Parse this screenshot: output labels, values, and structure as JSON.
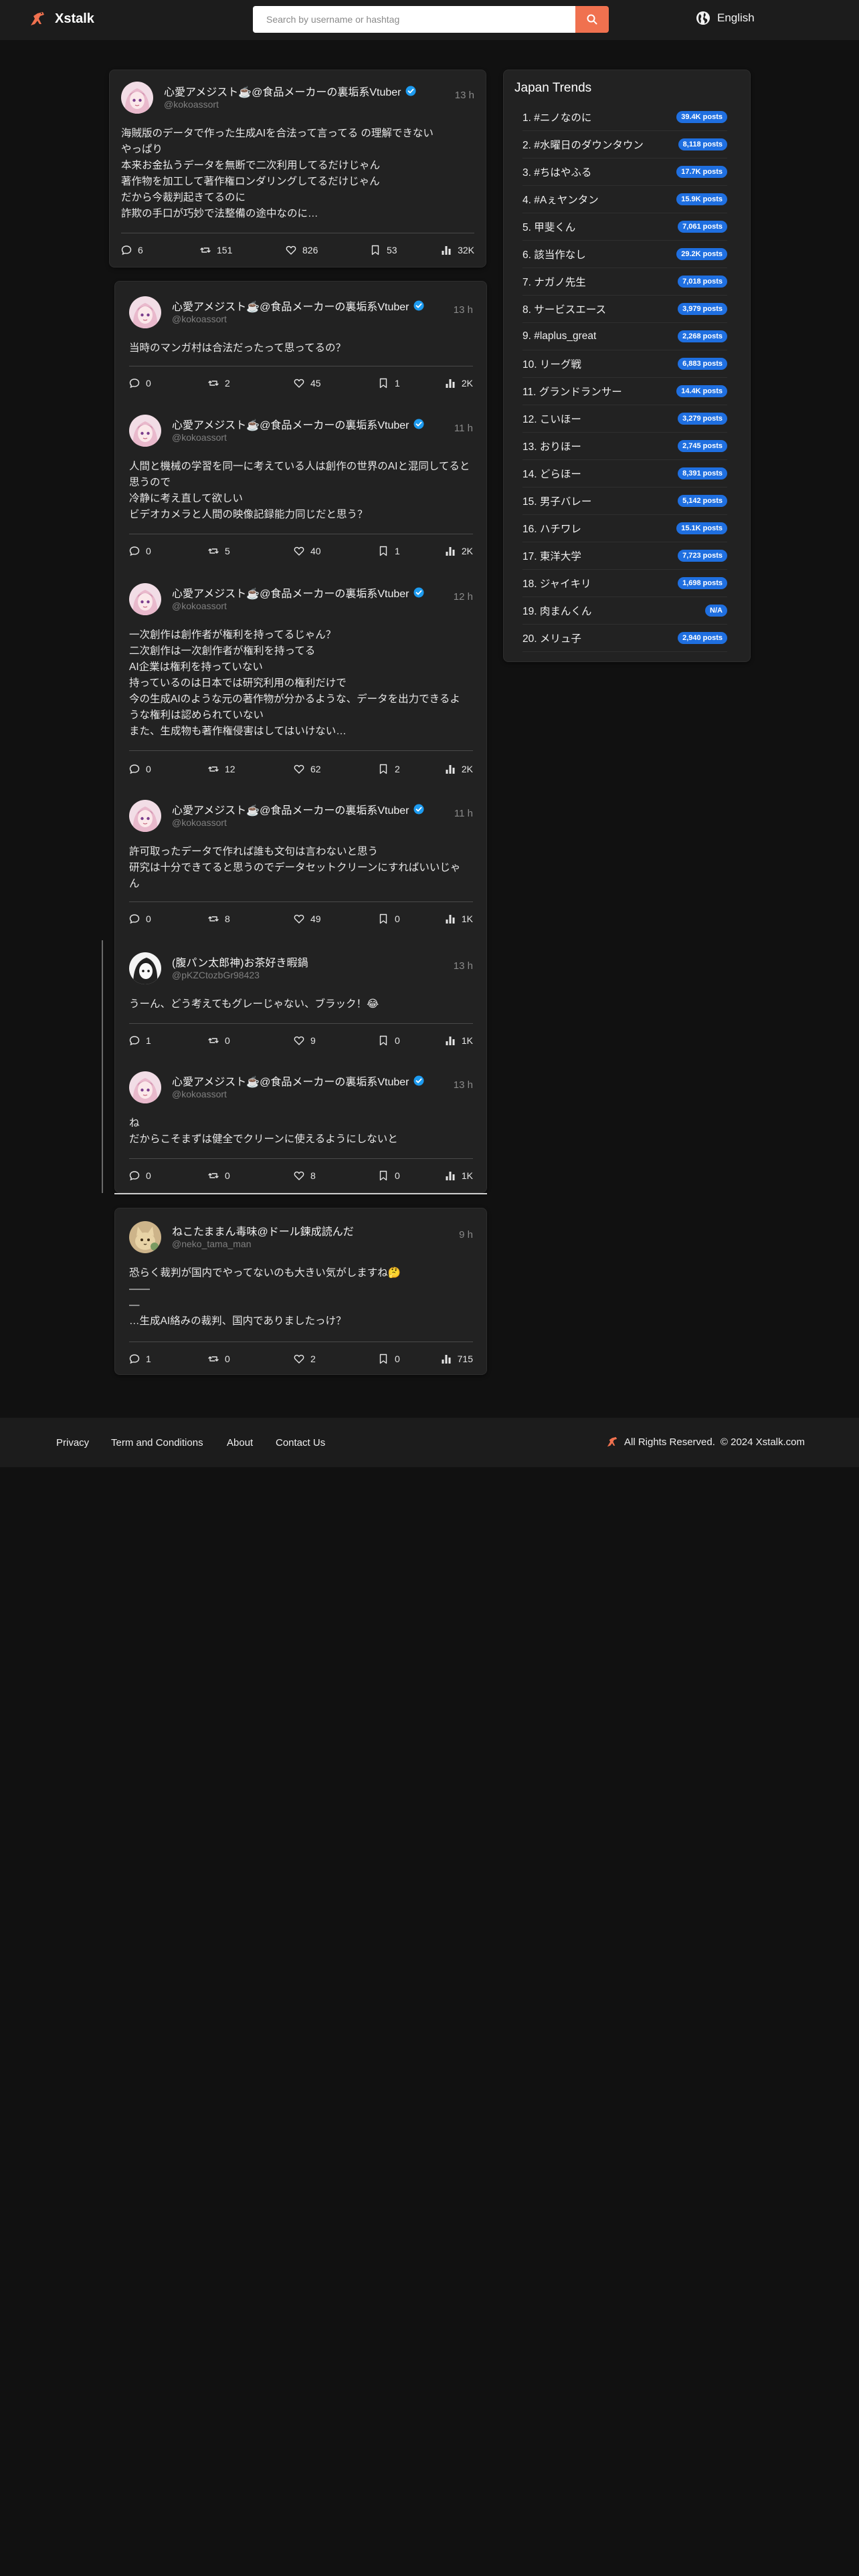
{
  "header": {
    "brand": "Xstalk",
    "search_placeholder": "Search by username or hashtag",
    "language": "English"
  },
  "tweets": [
    {
      "name": "心愛アメジスト☕️@食品メーカーの裏垢系Vtuber",
      "handle": "@kokoassort",
      "time": "13 h",
      "text": "海賊版のデータで作った生成AIを合法って言ってる の理解できない\nやっぱり\n本来お金払うデータを無断で二次利用してるだけじゃん\n著作物を加工して著作権ロンダリングしてるだけじゃん\nだから今裁判起きてるのに\n詐欺の手口が巧妙で法整備の途中なのに…",
      "replies": "6",
      "retweets": "151",
      "likes": "826",
      "bookmarks": "53",
      "views": "32K"
    },
    {
      "name": "心愛アメジスト☕️@食品メーカーの裏垢系Vtuber",
      "handle": "@kokoassort",
      "time": "13 h",
      "text": "当時のマンガ村は合法だったって思ってるの？",
      "replies": "0",
      "retweets": "2",
      "likes": "45",
      "bookmarks": "1",
      "views": "2K"
    },
    {
      "name": "心愛アメジスト☕️@食品メーカーの裏垢系Vtuber",
      "handle": "@kokoassort",
      "time": "11 h",
      "text": "人間と機械の学習を同一に考えている人は創作の世界のAIと混同してると思うので\n冷静に考え直して欲しい\nビデオカメラと人間の映像記録能力同じだと思う？",
      "replies": "0",
      "retweets": "5",
      "likes": "40",
      "bookmarks": "1",
      "views": "2K"
    },
    {
      "name": "心愛アメジスト☕️@食品メーカーの裏垢系Vtuber",
      "handle": "@kokoassort",
      "time": "12 h",
      "text": "一次創作は創作者が権利を持ってるじゃん？\n二次創作は一次創作者が権利を持ってる\nAI企業は権利を持っていない\n持っているのは日本では研究利用の権利だけで\n今の生成AIのような元の著作物が分かるような、データを出力できるような権利は認められていない\nまた、生成物も著作権侵害はしてはいけない…",
      "replies": "0",
      "retweets": "12",
      "likes": "62",
      "bookmarks": "2",
      "views": "2K"
    },
    {
      "name": "心愛アメジスト☕️@食品メーカーの裏垢系Vtuber",
      "handle": "@kokoassort",
      "time": "11 h",
      "text": "許可取ったデータで作れば誰も文句は言わないと思う\n研究は十分できてると思うのでデータセットクリーンにすればいいじゃん",
      "replies": "0",
      "retweets": "8",
      "likes": "49",
      "bookmarks": "0",
      "views": "1K"
    },
    {
      "name": "(腹パン太郎神)お茶好き暇鍋",
      "handle": "@pKZCtozbGr98423",
      "time": "13 h",
      "text": "うーん、どう考えてもグレーじゃない、ブラック！😂",
      "replies": "1",
      "retweets": "0",
      "likes": "9",
      "bookmarks": "0",
      "views": "1K"
    },
    {
      "name": "心愛アメジスト☕️@食品メーカーの裏垢系Vtuber",
      "handle": "@kokoassort",
      "time": "13 h",
      "text": "ね\nだからこそまずは健全でクリーンに使えるようにしないと",
      "replies": "0",
      "retweets": "0",
      "likes": "8",
      "bookmarks": "0",
      "views": "1K"
    },
    {
      "name": "ねこたままん毒味@ドール鍊成読んだ",
      "handle": "@neko_tama_man",
      "time": "9 h",
      "text": "恐らく裁判が国内でやってないのも大きい気がしますね🤔\n——\n—\n…生成AI絡みの裁判、国内でありましたっけ？",
      "replies": "1",
      "retweets": "0",
      "likes": "2",
      "bookmarks": "0",
      "views": "715"
    }
  ],
  "trends": {
    "title": "Japan Trends",
    "items": [
      {
        "name": "1. #ニノなのに",
        "count": "39.4K posts"
      },
      {
        "name": "2. #水曜日のダウンタウン",
        "count": "8,118 posts"
      },
      {
        "name": "3. #ちはやふる",
        "count": "17.7K posts"
      },
      {
        "name": "4. #Aぇヤンタン",
        "count": "15.9K posts"
      },
      {
        "name": "5. 甲斐くん",
        "count": "7,061 posts"
      },
      {
        "name": "6. 該当作なし",
        "count": "29.2K posts"
      },
      {
        "name": "7. ナガノ先生",
        "count": "7,018 posts"
      },
      {
        "name": "8. サービスエース",
        "count": "3,979 posts"
      },
      {
        "name": "9. #laplus_great",
        "count": "2,268 posts"
      },
      {
        "name": "10. リーグ戦",
        "count": "6,883 posts"
      },
      {
        "name": "11. グランドランサー",
        "count": "14.4K posts"
      },
      {
        "name": "12. こいほー",
        "count": "3,279 posts"
      },
      {
        "name": "13. おりほー",
        "count": "2,745 posts"
      },
      {
        "name": "14. どらほー",
        "count": "8,391 posts"
      },
      {
        "name": "15. 男子バレー",
        "count": "5,142 posts"
      },
      {
        "name": "16. ハチワレ",
        "count": "15.1K posts"
      },
      {
        "name": "17. 東洋大学",
        "count": "7,723 posts"
      },
      {
        "name": "18. ジャイキリ",
        "count": "1,698 posts"
      },
      {
        "name": "19. 肉まんくん",
        "count": "N/A"
      },
      {
        "name": "20. メリュ子",
        "count": "2,940 posts"
      }
    ]
  },
  "footer": {
    "links": [
      "Privacy",
      "Term and Conditions",
      "About",
      "Contact Us"
    ],
    "rights": "All Rights Reserved.",
    "copyright": "© 2024 Xstalk.com"
  },
  "colors": {
    "accent": "#f0714f",
    "badge": "#1f6fe0",
    "verified": "#1d9bf0",
    "background": "#111111",
    "card": "#222222"
  }
}
